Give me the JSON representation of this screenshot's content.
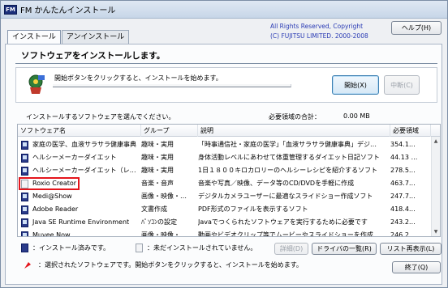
{
  "window": {
    "title": "FM かんたんインストール",
    "icon_text": "FM"
  },
  "tabs": [
    {
      "label": "インストール",
      "active": true
    },
    {
      "label": "アンインストール",
      "active": false
    }
  ],
  "copyright": {
    "line1": "All Rights Reserved, Copyright",
    "line2": "(C) FUJITSU LIMITED.  2000-2008"
  },
  "help_button": "ヘルプ(H)",
  "heading": "ソフトウェアをインストールします。",
  "progress": {
    "message": "開始ボタンをクリックすると、インストールを始めます。",
    "value": 0
  },
  "buttons": {
    "start": "開始(X)",
    "stop": "中断(C)",
    "detail": "詳細(D)",
    "driver_list": "ドライバの一覧(R)",
    "list_redisplay": "リスト再表示(L)",
    "exit": "終了(Q)"
  },
  "selection": {
    "prompt": "インストールするソフトウェアを選んでください。",
    "required_space_label": "必要領域の合計：",
    "required_space_value": "0.00 MB"
  },
  "list": {
    "columns": [
      "ソフトウェア名",
      "グループ",
      "説明",
      "必要領域"
    ],
    "rows": [
      {
        "name": "家庭の医学、血液サラサラ健康事典",
        "group": "趣味・実用",
        "description": "「時事通信社・家庭の医学」「血液サラサラ健康事典」デジ…",
        "size": "354.1…",
        "installed": true
      },
      {
        "name": "ヘルシーメーカーダイエット",
        "group": "趣味・実用",
        "description": "身体活動レベルにあわせて体重管理するダイエット日記ソフト",
        "size": "44.13 …",
        "installed": true
      },
      {
        "name": "ヘルシーメーカーダイエット（レ…",
        "group": "趣味・実用",
        "description": "1日１８００キロカロリーのヘルシーレシピを紹介するソフト",
        "size": "278.5…",
        "installed": true
      },
      {
        "name": "Roxio Creator",
        "group": "音楽・音声",
        "description": "音楽や写真／映像、データ等のCD/DVDを手軽に作成",
        "size": "463.7…",
        "installed": false
      },
      {
        "name": "Medi@Show",
        "group": "画像・映像・…",
        "description": "デジタルカメラユーザーに最適なスライドショー作成ソフト",
        "size": "247.7…",
        "installed": true
      },
      {
        "name": "Adobe Reader",
        "group": "文書作成",
        "description": "PDF形式のファイルを表示するソフト",
        "size": "418.4…",
        "installed": true
      },
      {
        "name": "Java SE Runtime Environment",
        "group": "ﾊﾟｿｺﾝの設定",
        "description": "Javaでつくられたソフトウェアを実行するために必要です",
        "size": "243.2…",
        "installed": true
      },
      {
        "name": "Muvee Now",
        "group": "画像・映像・…",
        "description": "動画やビデオクリップ等でムービーやスライドショーを作成",
        "size": "246.2…",
        "installed": true
      }
    ]
  },
  "legend": {
    "installed": "：インストール済みです。",
    "not_installed": "：未だインストールされていません。",
    "selected": "：選択されたソフトウェアです。開始ボタンをクリックすると、インストールを始めます。"
  },
  "colors": {
    "highlight": "#e4151c",
    "copyright": "#2a3bb4",
    "installed_icon": "#2b3b8a"
  }
}
